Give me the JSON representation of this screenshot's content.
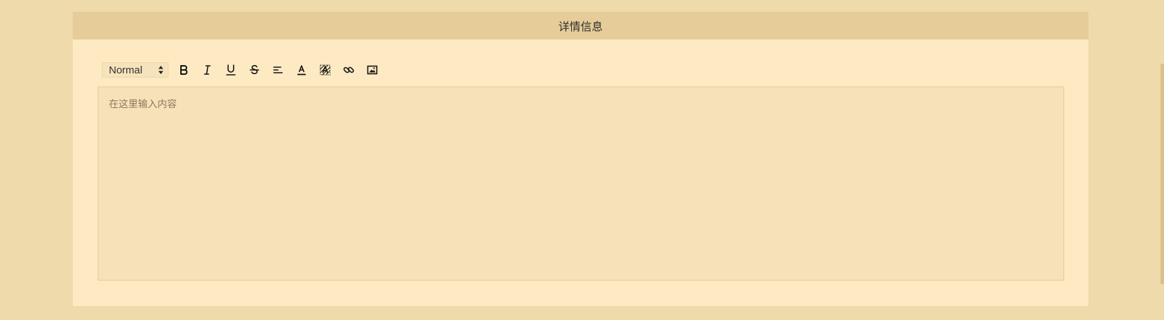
{
  "panel": {
    "title": "详情信息"
  },
  "toolbar": {
    "header_select": {
      "value": "Normal"
    },
    "buttons": [
      {
        "name": "bold",
        "icon": "bold-icon"
      },
      {
        "name": "italic",
        "icon": "italic-icon"
      },
      {
        "name": "underline",
        "icon": "underline-icon"
      },
      {
        "name": "strikethrough",
        "icon": "strikethrough-icon"
      },
      {
        "name": "align",
        "icon": "align-left-icon"
      },
      {
        "name": "font-color",
        "icon": "text-color-icon"
      },
      {
        "name": "background-color",
        "icon": "highlight-icon"
      },
      {
        "name": "link",
        "icon": "link-icon"
      },
      {
        "name": "image",
        "icon": "image-icon"
      }
    ]
  },
  "editor": {
    "placeholder": "在这里输入内容"
  },
  "colors": {
    "page_background": "#efdaab",
    "panel_background": "#fde9c2",
    "header_background": "#e6cc99",
    "editor_background": "#f7e1b9"
  }
}
